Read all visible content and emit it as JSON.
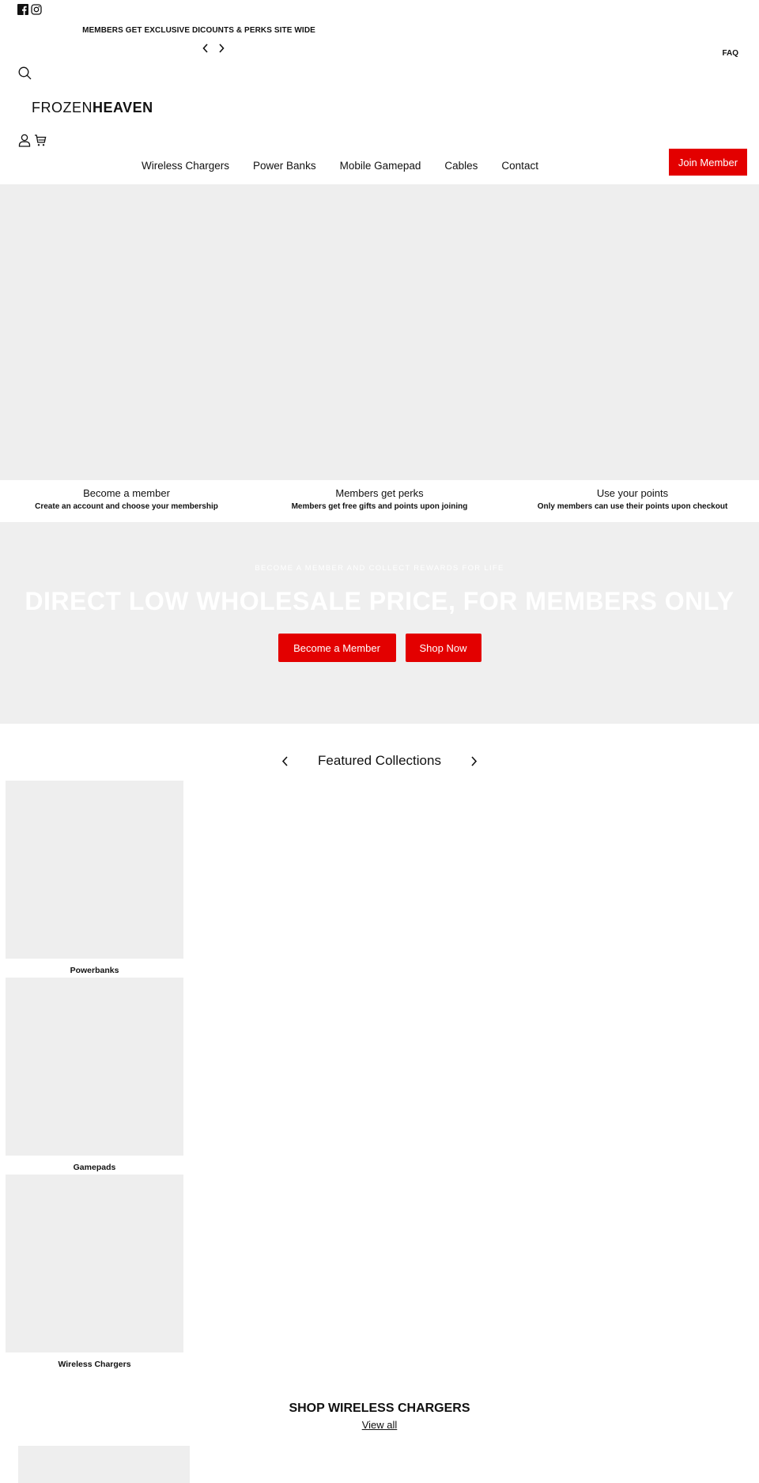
{
  "social": {
    "icons": [
      "facebook-icon",
      "instagram-icon"
    ]
  },
  "announcement": {
    "text": "MEMBERS GET EXCLUSIVE DICOUNTS & PERKS SITE WIDE",
    "prev_icon": "chevron-left-icon",
    "next_icon": "chevron-right-icon"
  },
  "header": {
    "faq_label": "FAQ",
    "search_icon": "search-icon",
    "logo_light": "FROZEN",
    "logo_bold": "HEAVEN",
    "account_icon": "user-icon",
    "cart_icon": "cart-icon",
    "join_label": "Join Member"
  },
  "nav": {
    "items": [
      {
        "label": "Wireless Chargers"
      },
      {
        "label": "Power Banks"
      },
      {
        "label": "Mobile Gamepad"
      },
      {
        "label": "Cables"
      },
      {
        "label": "Contact"
      }
    ]
  },
  "perks": [
    {
      "title": "Become a member",
      "text": "Create an account and choose your membership"
    },
    {
      "title": "Members get perks",
      "text": "Members get free gifts and points upon joining"
    },
    {
      "title": "Use your points",
      "text": "Only members can use their points upon checkout"
    }
  ],
  "banner": {
    "eyebrow": "BECOME A MEMBER AND COLLECT REWARDS FOR LIFE",
    "headline": "DIRECT LOW WHOLESALE PRICE, FOR MEMBERS ONLY",
    "cta_primary": "Become a Member",
    "cta_secondary": "Shop Now"
  },
  "featured": {
    "title": "Featured Collections",
    "collections": [
      {
        "label": "Powerbanks"
      },
      {
        "label": "Gamepads"
      },
      {
        "label": "Wireless Chargers"
      }
    ]
  },
  "shop_section": {
    "title": "SHOP WIRELESS CHARGERS",
    "view_all": "View all"
  },
  "colors": {
    "accent": "#e30000",
    "placeholder": "#eeeeee",
    "text": "#111111"
  }
}
